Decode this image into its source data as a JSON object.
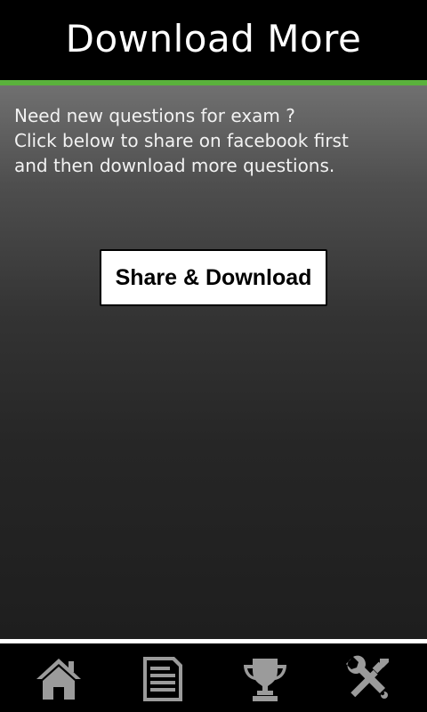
{
  "header": {
    "title": "Download More"
  },
  "content": {
    "message_lines": [
      "Need new questions for exam ?",
      "Click below to share on facebook first",
      "and then download more questions."
    ],
    "share_button_label": "Share & Download"
  },
  "bottom_nav": {
    "items": [
      {
        "icon": "home-icon"
      },
      {
        "icon": "document-list-icon"
      },
      {
        "icon": "trophy-icon"
      },
      {
        "icon": "tools-icon"
      }
    ]
  },
  "colors": {
    "accent": "#5ab23c",
    "header_background": "#000000",
    "icon_color": "#9b9b9b"
  }
}
